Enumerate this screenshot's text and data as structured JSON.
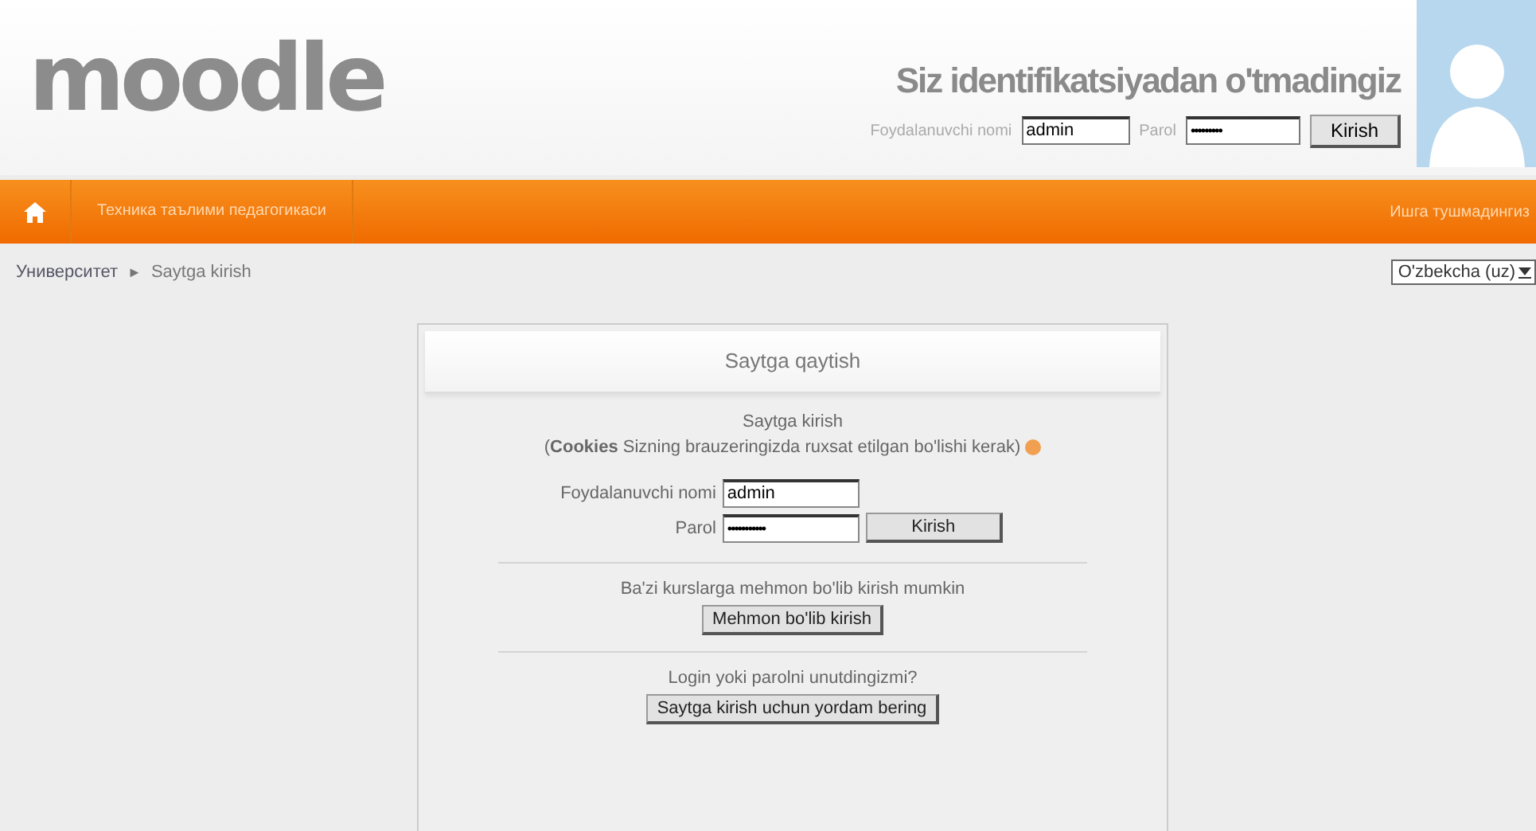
{
  "header": {
    "logo": "moodle",
    "status": "Siz identifikatsiyadan o'tmadingiz",
    "username_label": "Foydalanuvchi nomi",
    "username": "admin",
    "password_label": "Parol",
    "password": "•••••••••",
    "login_button": "Kirish"
  },
  "navbar": {
    "items": [
      {
        "label": "Техника таълими педагогикаси"
      }
    ],
    "right_text": "Ишга тушмадингиз"
  },
  "breadcrumb": {
    "items": [
      "Университет",
      "Saytga kirish"
    ],
    "separator": "►",
    "language": "O'zbekcha (uz)"
  },
  "panel": {
    "title": "Saytga qaytish",
    "heading": "Saytga kirish",
    "cookies_note": "(**Cookies** Sizning brauzeringizda ruxsat etilgan bo'lishi kerak)",
    "username_label": "Foydalanuvchi nomi",
    "username": "admin",
    "password_label": "Parol",
    "password": "•••••••••••",
    "login_button": "Kirish",
    "guest_text": "Ba'zi kurslarga mehmon bo'lib kirish mumkin",
    "guest_button": "Mehmon bo'lib kirish",
    "forgot_text": "Login yoki parolni unutdingizmi?",
    "forgot_button": "Saytga kirish uchun yordam bering"
  }
}
